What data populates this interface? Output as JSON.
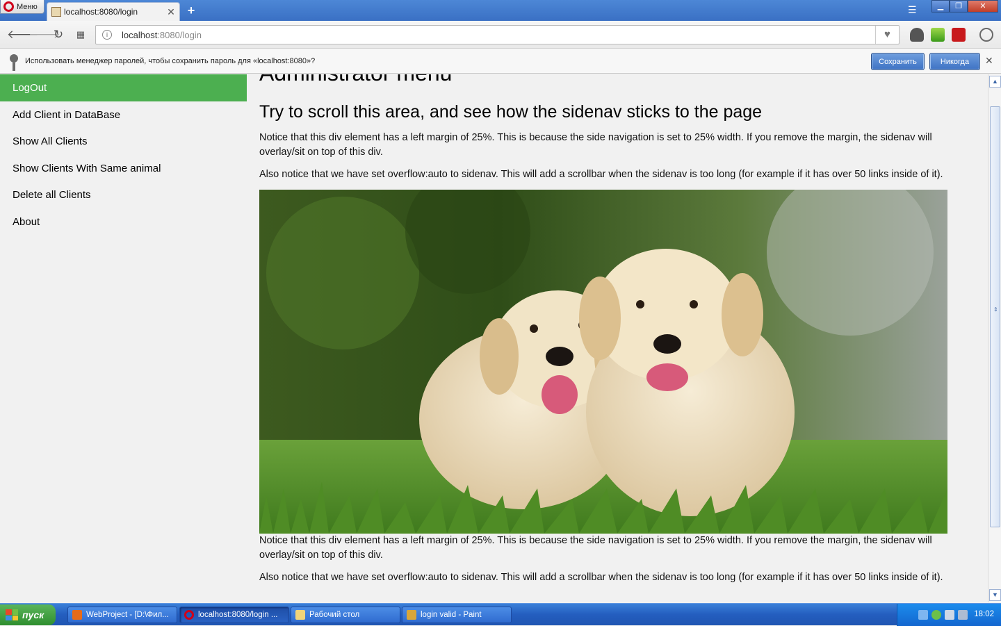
{
  "browser": {
    "menu_label": "Меню",
    "tab_title": "localhost:8080/login",
    "url_host": "localhost",
    "url_rest": ":8080/login"
  },
  "infobar": {
    "message": "Использовать менеджер паролей, чтобы сохранить пароль для «localhost:8080»?",
    "save_label": "Сохранить",
    "never_label": "Никогда"
  },
  "sidenav": {
    "items": [
      {
        "label": "LogOut"
      },
      {
        "label": "Add Client in DataBase"
      },
      {
        "label": "Show All Clients"
      },
      {
        "label": "Show Clients With Same animal"
      },
      {
        "label": "Delete all Clients"
      },
      {
        "label": "About"
      }
    ]
  },
  "main": {
    "title": "Administrator menu",
    "subtitle": "Try to scroll this area, and see how the sidenav sticks to the page",
    "paragraph_margin": "Notice that this div element has a left margin of 25%. This is because the side navigation is set to 25% width. If you remove the margin, the sidenav will overlay/sit on top of this div.",
    "paragraph_overflow": "Also notice that we have set overflow:auto to sidenav. This will add a scrollbar when the sidenav is too long (for example if it has over 50 links inside of it)."
  },
  "taskbar": {
    "start_label": "пуск",
    "tasks": [
      {
        "label": "WebProject - [D:\\Фил..."
      },
      {
        "label": "localhost:8080/login ..."
      },
      {
        "label": "Рабочий стол"
      },
      {
        "label": "login valid - Paint"
      }
    ],
    "clock": "18:02"
  },
  "colors": {
    "active_nav": "#4caf50",
    "taskbar": "#245ebf"
  }
}
